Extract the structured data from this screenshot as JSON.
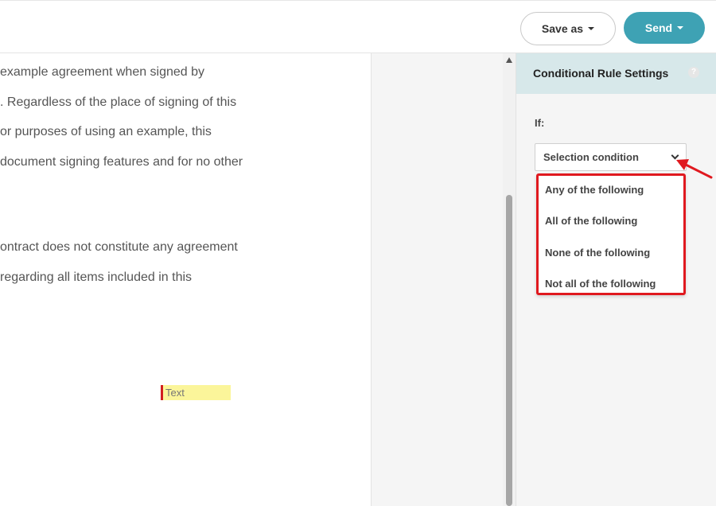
{
  "toolbar": {
    "save_as_label": "Save as",
    "send_label": "Send"
  },
  "document": {
    "lines": [
      "example agreement when signed by",
      ". Regardless of the place of signing of this",
      "or purposes of using an example, this",
      "document signing features and for no other",
      "ontract does not constitute any agreement",
      "regarding all items included in this"
    ],
    "text_field_label": "Text"
  },
  "panel": {
    "title": "Conditional Rule Settings",
    "help_icon": "?",
    "if_label": "If:",
    "select_value": "Selection condition",
    "options": [
      "Any of the following",
      "All of the following",
      "None of the following",
      "Not all of the following"
    ]
  },
  "colors": {
    "send_button": "#3ea2b4",
    "panel_header": "#d7e8ea",
    "annotation_red": "#e0191f",
    "text_field_fill": "#fbf59a"
  }
}
